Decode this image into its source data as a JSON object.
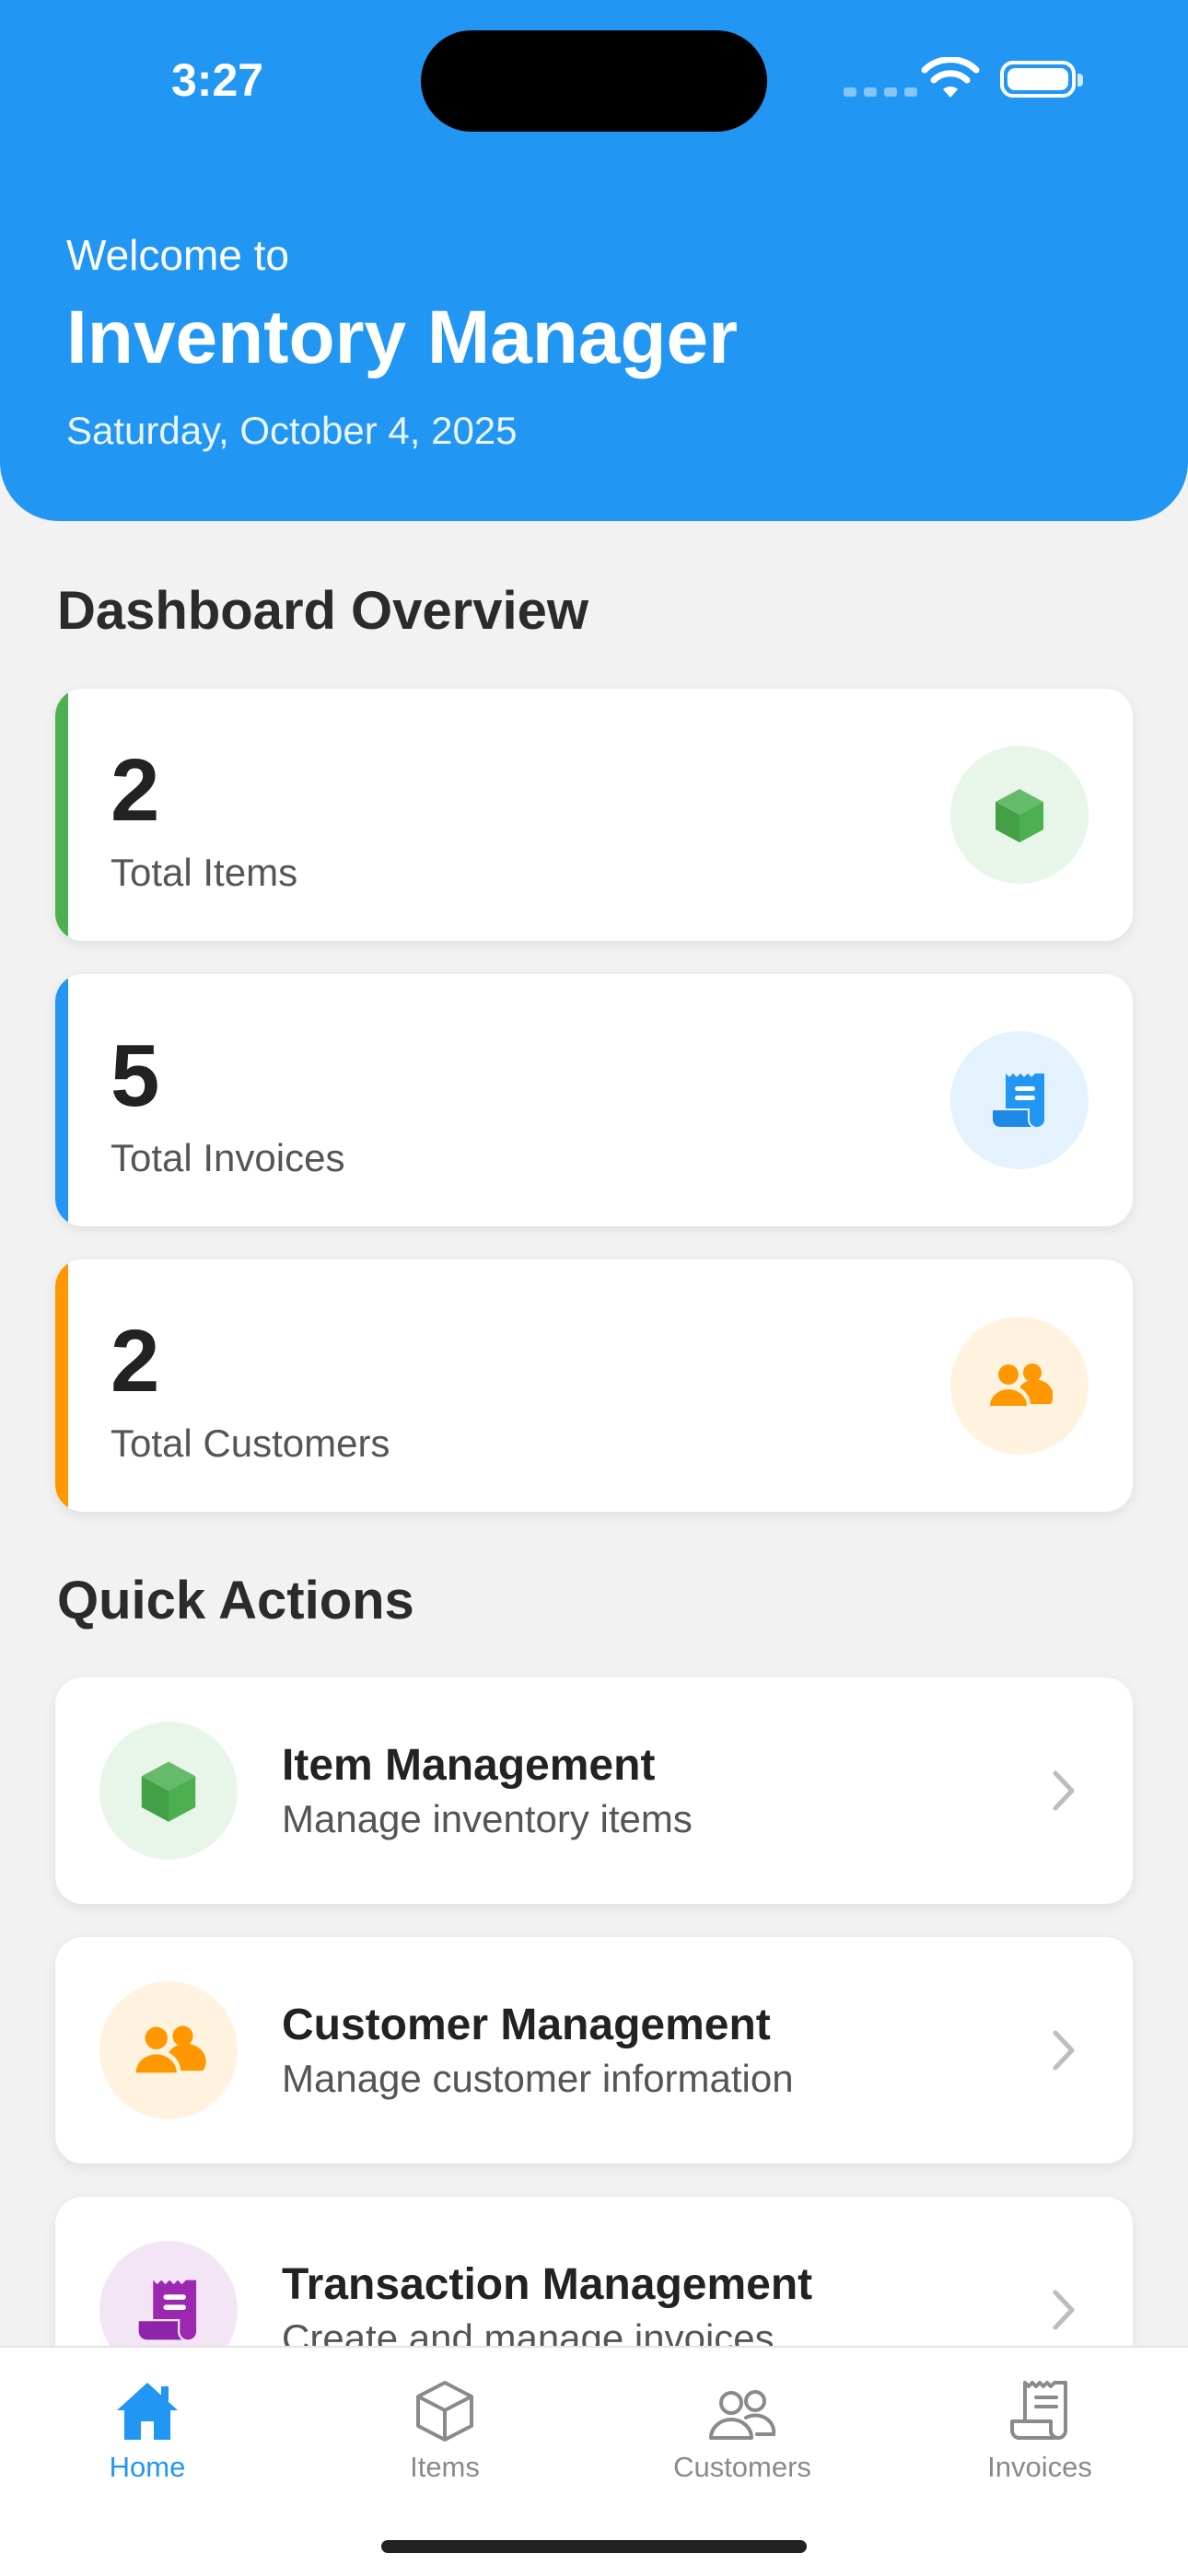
{
  "status": {
    "time": "3:27"
  },
  "header": {
    "welcome": "Welcome to",
    "title": "Inventory Manager",
    "date": "Saturday, October 4, 2025"
  },
  "dashboard": {
    "title": "Dashboard Overview",
    "stats": [
      {
        "value": "2",
        "label": "Total Items",
        "accent": "#4caf50",
        "icon": "cube-icon",
        "icon_bg": "#e8f5e9"
      },
      {
        "value": "5",
        "label": "Total Invoices",
        "accent": "#2196f3",
        "icon": "receipt-icon",
        "icon_bg": "#e3f2fd"
      },
      {
        "value": "2",
        "label": "Total Customers",
        "accent": "#ff9800",
        "icon": "people-icon",
        "icon_bg": "#fff3e0"
      }
    ]
  },
  "quick_actions": {
    "title": "Quick Actions",
    "items": [
      {
        "title": "Item Management",
        "subtitle": "Manage inventory items",
        "icon": "cube-icon",
        "color": "#4caf50",
        "icon_bg": "#e8f5e9"
      },
      {
        "title": "Customer Management",
        "subtitle": "Manage customer information",
        "icon": "people-icon",
        "color": "#ff9800",
        "icon_bg": "#fff3e0"
      },
      {
        "title": "Transaction Management",
        "subtitle": "Create and manage invoices",
        "icon": "receipt-icon",
        "color": "#9c27b0",
        "icon_bg": "#f3e5f5"
      }
    ]
  },
  "tabs": [
    {
      "label": "Home",
      "icon": "house-icon",
      "active": true
    },
    {
      "label": "Items",
      "icon": "cube-outline-icon",
      "active": false
    },
    {
      "label": "Customers",
      "icon": "people-outline-icon",
      "active": false
    },
    {
      "label": "Invoices",
      "icon": "receipt-outline-icon",
      "active": false
    }
  ],
  "colors": {
    "primary": "#2196f3",
    "background": "#f2f2f2"
  }
}
